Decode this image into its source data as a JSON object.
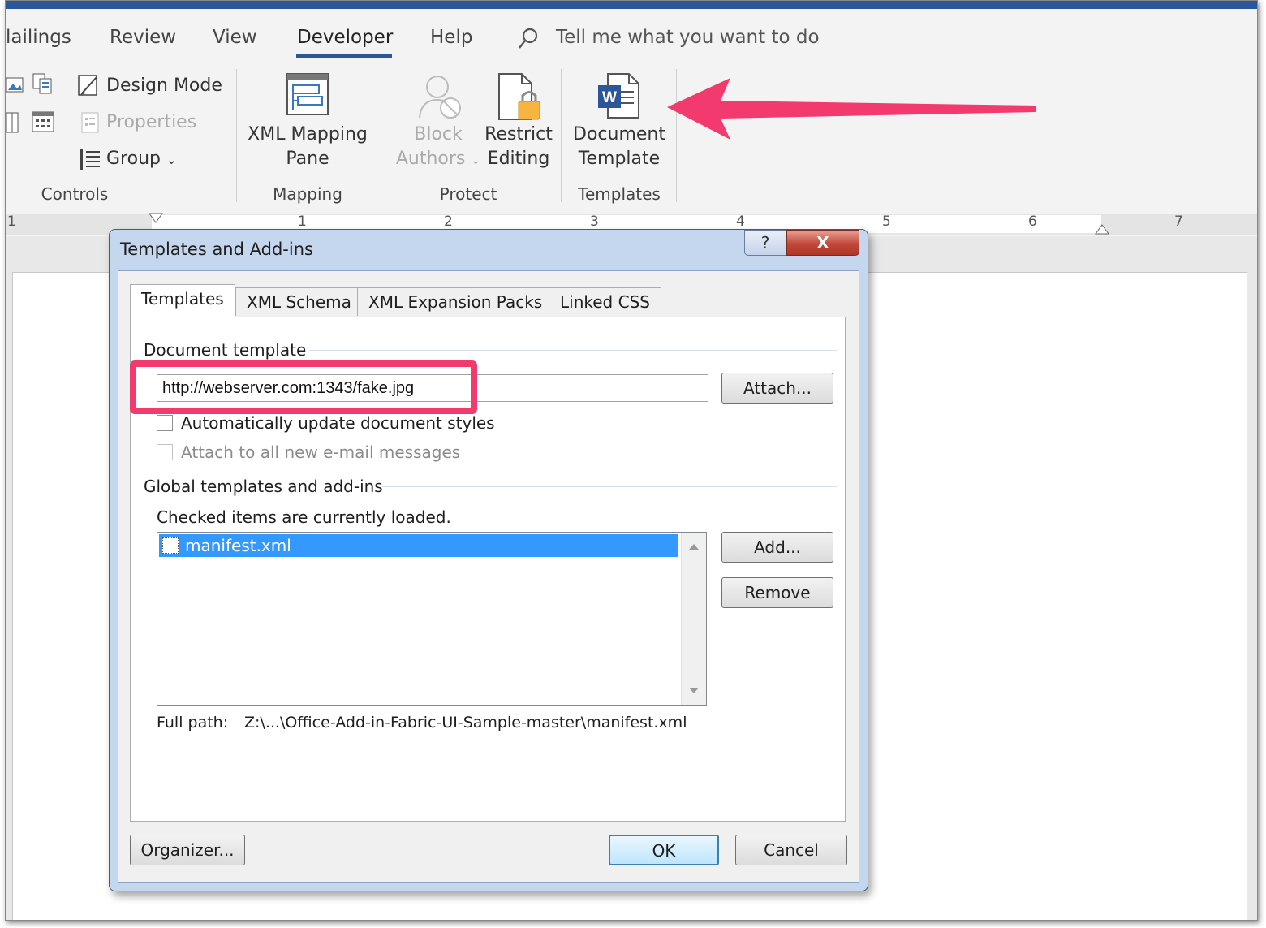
{
  "ribbon": {
    "tabs": [
      "lailings",
      "Review",
      "View",
      "Developer",
      "Help"
    ],
    "active_tab": "Developer",
    "tell_me": "Tell me what you want to do",
    "controls": {
      "design_mode": "Design Mode",
      "properties": "Properties",
      "group": "Group",
      "label": "Controls"
    },
    "mapping": {
      "xml_mapping_line1": "XML Mapping",
      "xml_mapping_line2": "Pane",
      "label": "Mapping"
    },
    "protect": {
      "block_line1": "Block",
      "block_line2": "Authors",
      "restrict_line1": "Restrict",
      "restrict_line2": "Editing",
      "label": "Protect"
    },
    "templates": {
      "doc_template_line1": "Document",
      "doc_template_line2": "Template",
      "label": "Templates"
    }
  },
  "ruler": {
    "marks": [
      "1",
      "1",
      "2",
      "3",
      "4",
      "5",
      "6",
      "7"
    ]
  },
  "dialog": {
    "title": "Templates and Add-ins",
    "help_glyph": "?",
    "close_glyph": "X",
    "tabs": [
      "Templates",
      "XML Schema",
      "XML Expansion Packs",
      "Linked CSS"
    ],
    "document_template_label": "Document template",
    "template_path": "http://webserver.com:1343/fake.jpg",
    "attach_button": "Attach...",
    "auto_update_label": "Automatically update document styles",
    "attach_all_label": "Attach to all new e-mail messages",
    "global_label": "Global templates and add-ins",
    "checked_note": "Checked items are currently loaded.",
    "list_items": [
      "manifest.xml"
    ],
    "add_button": "Add...",
    "remove_button": "Remove",
    "full_path_label": "Full path:",
    "full_path_value": "Z:\\...\\Office-Add-in-Fabric-UI-Sample-master\\manifest.xml",
    "organizer_button": "Organizer...",
    "ok_button": "OK",
    "cancel_button": "Cancel"
  },
  "colors": {
    "accent": "#2b579a",
    "annotation": "#f23a6e",
    "selection": "#3399ff"
  }
}
